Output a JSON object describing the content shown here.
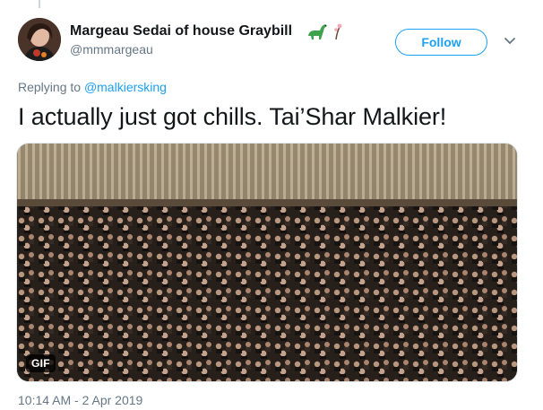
{
  "tweet": {
    "author": {
      "display_name": "Margeau Sedai of house Graybill",
      "name_emoji": [
        "sauropod-emoji",
        "blossom-emoji"
      ],
      "handle": "@mmmargeau",
      "avatar": "avatar-photo"
    },
    "follow_label": "Follow",
    "menu_icon": "chevron-down-icon",
    "reply": {
      "prefix": "Replying to ",
      "mention": "@malkiersking"
    },
    "text": "I actually just got chills. Tai’Shar Malkier!",
    "media": {
      "kind": "animated-gif",
      "badge": "GIF",
      "description_icon": "audience-clapping-gif"
    },
    "timestamp": "10:14 AM - 2 Apr 2019"
  },
  "colors": {
    "accent": "#1da1f2",
    "secondary_text": "#657786",
    "primary_text": "#14171a",
    "border": "#e1e8ed"
  }
}
